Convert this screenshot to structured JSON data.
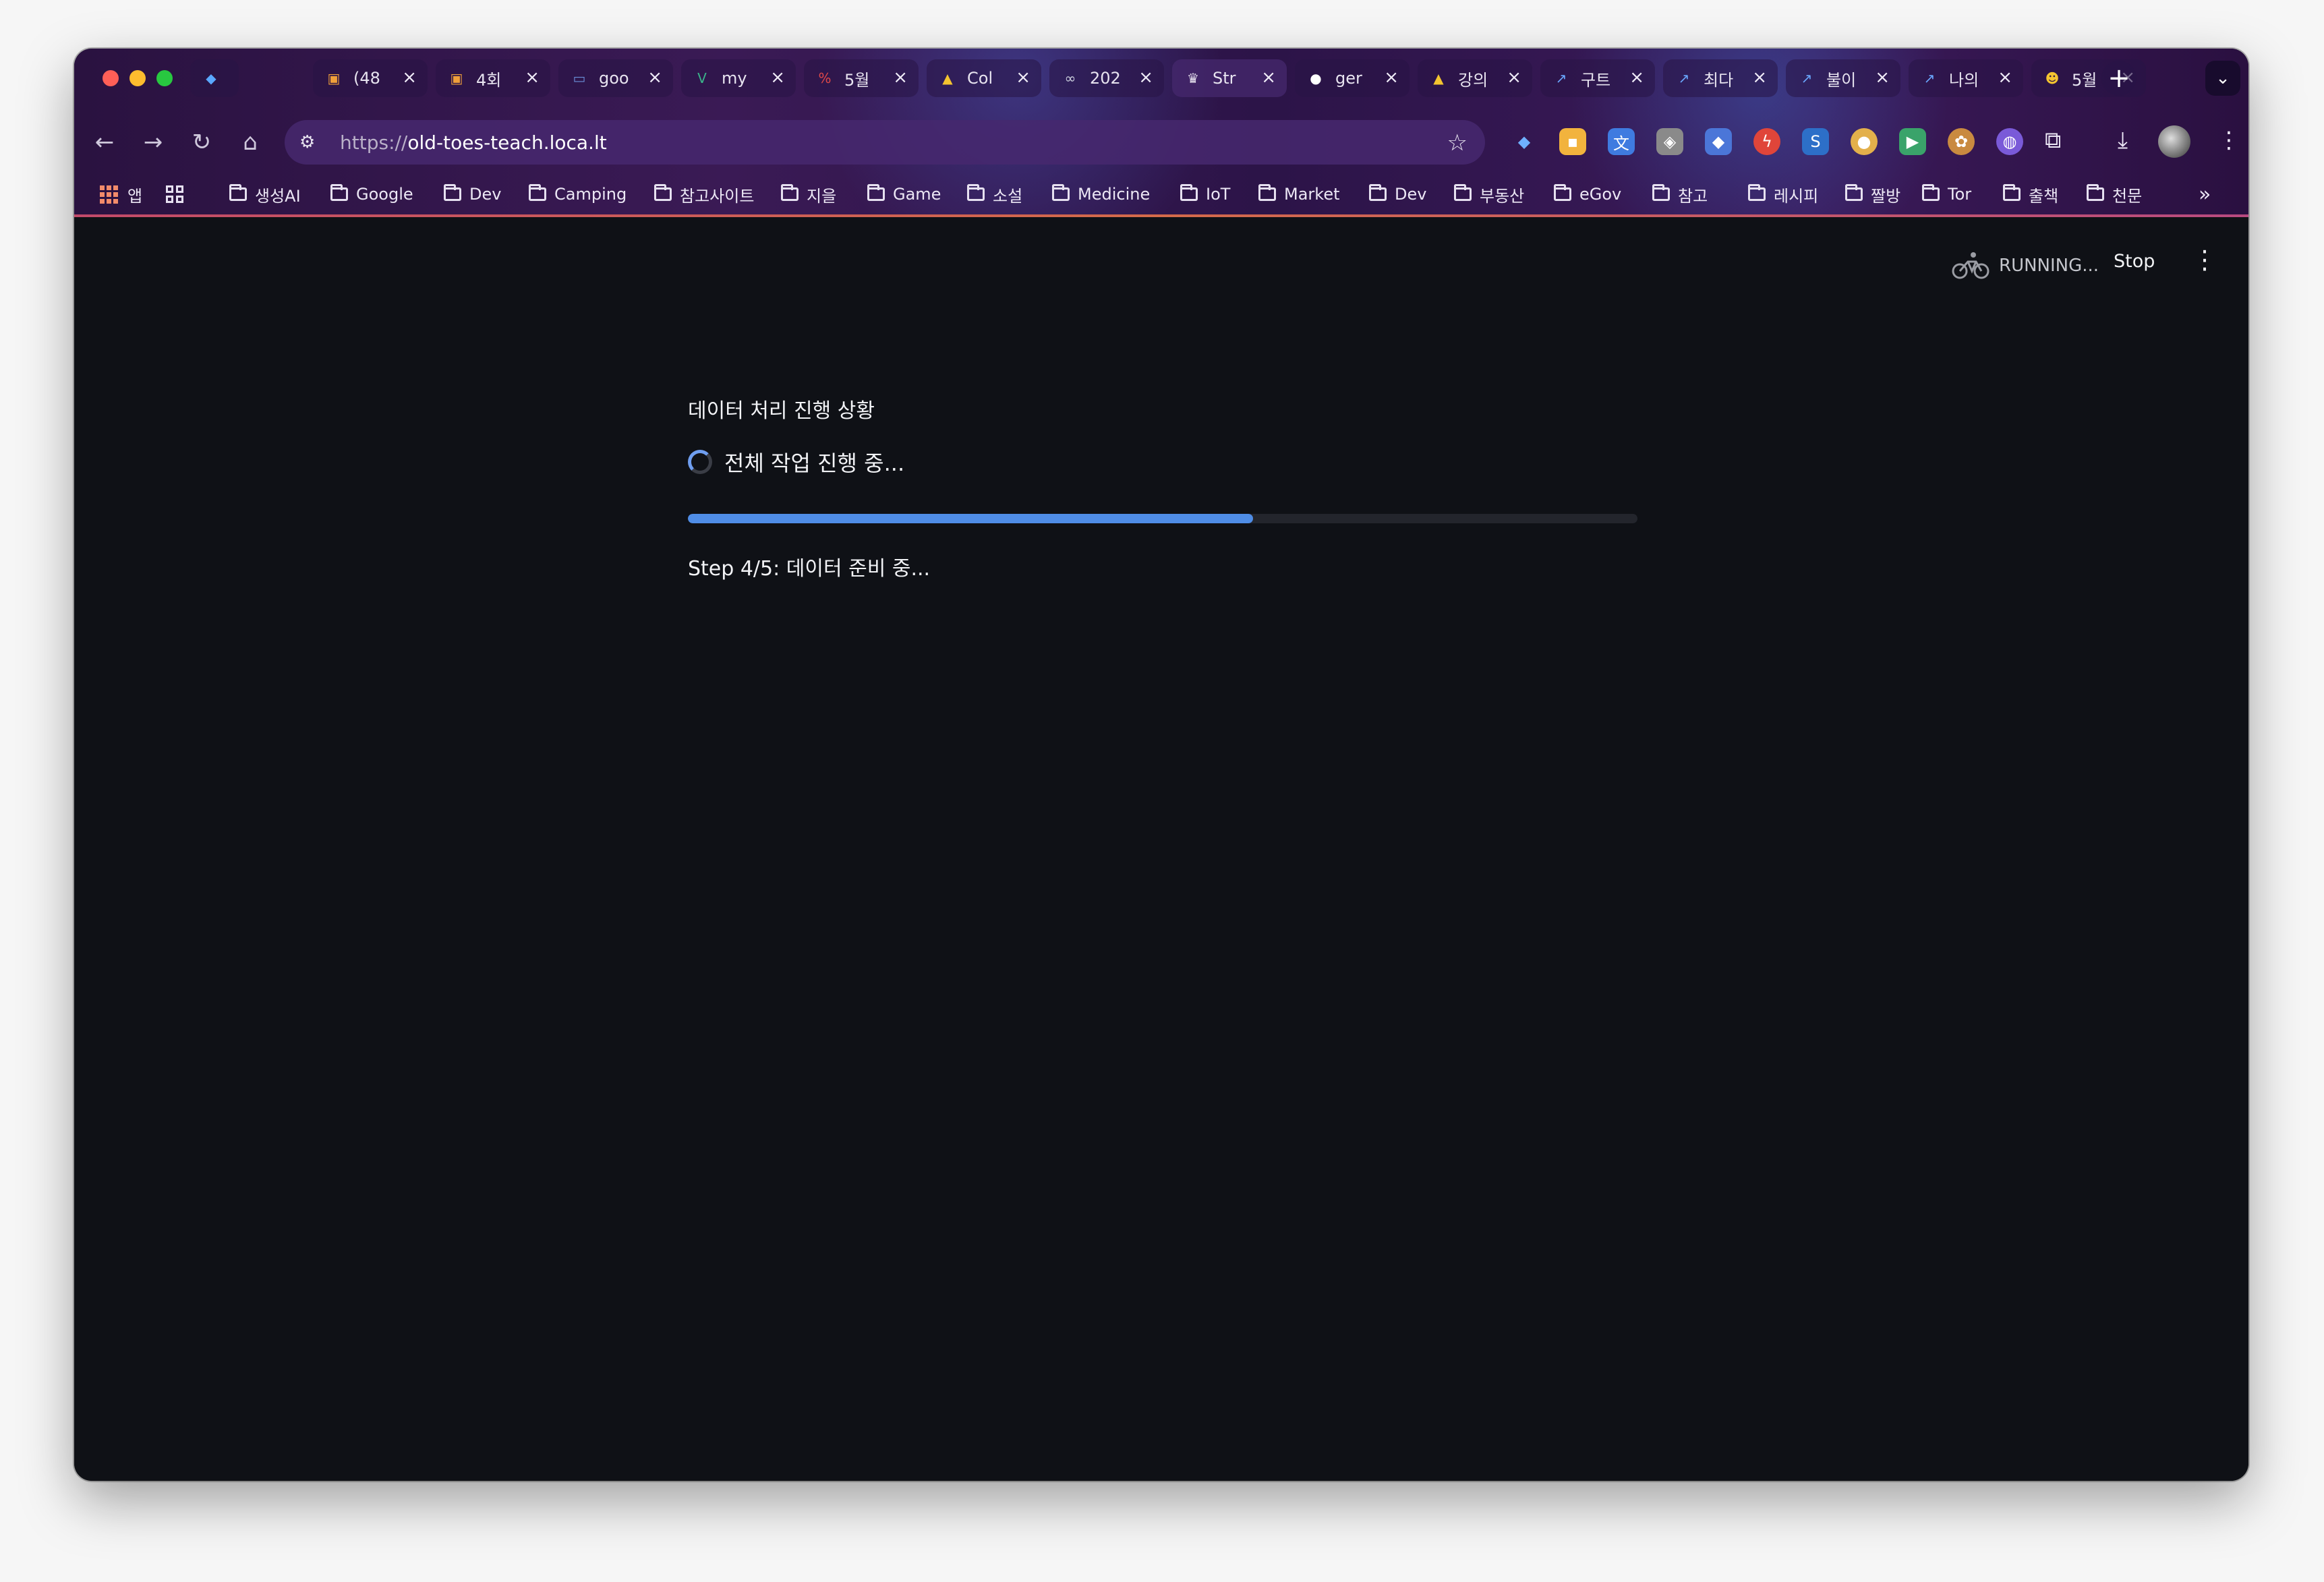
{
  "tabs": [
    {
      "title": "",
      "icon": "gem-icon",
      "active": false
    },
    {
      "title": "(48",
      "icon": "box-icon",
      "active": false
    },
    {
      "title": "4회",
      "icon": "box-icon",
      "active": false
    },
    {
      "title": "goo",
      "icon": "monitor-icon",
      "active": false
    },
    {
      "title": "my",
      "icon": "v-icon",
      "active": false
    },
    {
      "title": "5월",
      "icon": "hundred-icon",
      "active": false
    },
    {
      "title": "Col",
      "icon": "drive-icon",
      "active": false
    },
    {
      "title": "202",
      "icon": "infinity-icon",
      "active": false
    },
    {
      "title": "Str",
      "icon": "crown-icon",
      "active": true
    },
    {
      "title": "ger",
      "icon": "github-icon",
      "active": false
    },
    {
      "title": "강의",
      "icon": "drive-icon",
      "active": false
    },
    {
      "title": "구트",
      "icon": "arrow-icon",
      "active": false
    },
    {
      "title": "최다",
      "icon": "arrow-icon",
      "active": false
    },
    {
      "title": "불이",
      "icon": "arrow-icon",
      "active": false
    },
    {
      "title": "나의",
      "icon": "arrow-icon",
      "active": false
    },
    {
      "title": "5월",
      "icon": "emoji-icon",
      "active": false
    }
  ],
  "address_bar": {
    "scheme": "https://",
    "host": "old-toes-teach.loca.lt"
  },
  "bookmarks": {
    "apps_label": "앱",
    "folders": [
      "생성AI",
      "Google",
      "Dev",
      "Camping",
      "참고사이트",
      "지을",
      "Game",
      "소설",
      "Medicine",
      "IoT",
      "Market",
      "Dev",
      "부동산",
      "eGov",
      "참고",
      "레시피",
      "짤방",
      "Tor",
      "출책",
      "천문"
    ]
  },
  "app_status": {
    "running_label": "RUNNING...",
    "stop_label": "Stop"
  },
  "main": {
    "title": "데이터 처리 진행 상황",
    "overall_label": "전체 작업 진행 중...",
    "progress_fraction": 0.595,
    "step_text": "Step 4/5: 데이터 준비 중..."
  },
  "colors": {
    "accent": "#4f8de6",
    "background": "#0f1116"
  }
}
